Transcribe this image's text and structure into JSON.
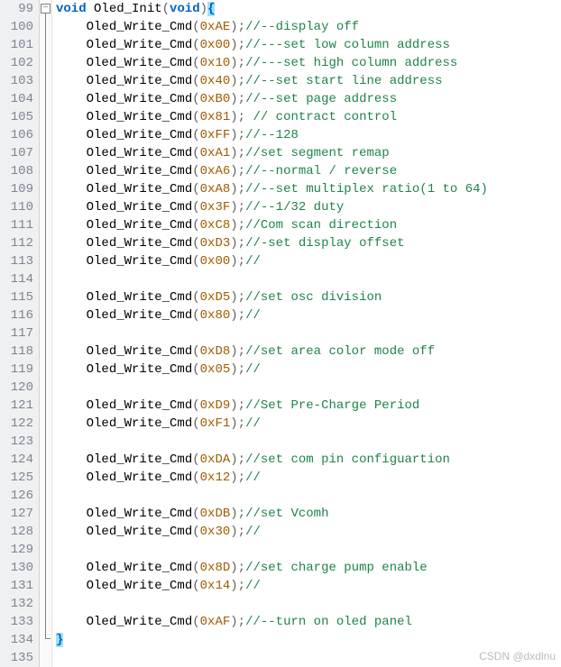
{
  "editor": {
    "first_line": 99,
    "last_line": 135,
    "fold_open_glyph": "−",
    "function_signature": {
      "ret_type": "void",
      "name": "Oled_Init",
      "param_type": "void"
    },
    "open_brace": "{",
    "close_brace": "}",
    "call_name": "Oled_Write_Cmd",
    "lp": "(",
    "rp": ")",
    "semi": ";",
    "space": " ",
    "indent": "    ",
    "lines": [
      {
        "arg": "0xAE",
        "cmt": "//--display off"
      },
      {
        "arg": "0x00",
        "cmt": "//---set low column address"
      },
      {
        "arg": "0x10",
        "cmt": "//---set high column address"
      },
      {
        "arg": "0x40",
        "cmt": "//--set start line address"
      },
      {
        "arg": "0xB0",
        "cmt": "//--set page address"
      },
      {
        "arg": "0x81",
        "cmt": " // contract control"
      },
      {
        "arg": "0xFF",
        "cmt": "//--128"
      },
      {
        "arg": "0xA1",
        "cmt": "//set segment remap"
      },
      {
        "arg": "0xA6",
        "cmt": "//--normal / reverse"
      },
      {
        "arg": "0xA8",
        "cmt": "//--set multiplex ratio(1 to 64)"
      },
      {
        "arg": "0x3F",
        "cmt": "//--1/32 duty"
      },
      {
        "arg": "0xC8",
        "cmt": "//Com scan direction"
      },
      {
        "arg": "0xD3",
        "cmt": "//-set display offset"
      },
      {
        "arg": "0x00",
        "cmt": "//"
      },
      {
        "blank": true
      },
      {
        "arg": "0xD5",
        "cmt": "//set osc division"
      },
      {
        "arg": "0x80",
        "cmt": "//"
      },
      {
        "blank": true
      },
      {
        "arg": "0xD8",
        "cmt": "//set area color mode off"
      },
      {
        "arg": "0x05",
        "cmt": "//"
      },
      {
        "blank": true
      },
      {
        "arg": "0xD9",
        "cmt": "//Set Pre-Charge Period"
      },
      {
        "arg": "0xF1",
        "cmt": "//"
      },
      {
        "blank": true
      },
      {
        "arg": "0xDA",
        "cmt": "//set com pin configuartion"
      },
      {
        "arg": "0x12",
        "cmt": "//"
      },
      {
        "blank": true
      },
      {
        "arg": "0xDB",
        "cmt": "//set Vcomh"
      },
      {
        "arg": "0x30",
        "cmt": "//"
      },
      {
        "blank": true
      },
      {
        "arg": "0x8D",
        "cmt": "//set charge pump enable"
      },
      {
        "arg": "0x14",
        "cmt": "//"
      },
      {
        "blank": true
      },
      {
        "arg": "0xAF",
        "cmt": "//--turn on oled panel"
      }
    ]
  },
  "colors": {
    "keyword": "#0060c0",
    "number": "#a05a00",
    "comment": "#1e8449",
    "punct": "#606060",
    "brace_hl": "#9fe0ff"
  },
  "watermark": "CSDN @dxdlnu"
}
